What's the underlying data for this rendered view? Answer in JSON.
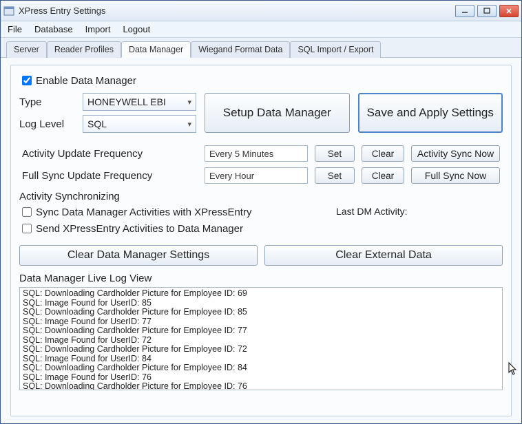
{
  "window": {
    "title": "XPress Entry Settings"
  },
  "menu": {
    "items": [
      "File",
      "Database",
      "Import",
      "Logout"
    ]
  },
  "tabs": {
    "items": [
      "Server",
      "Reader Profiles",
      "Data Manager",
      "Wiegand Format Data",
      "SQL Import / Export"
    ],
    "active": 2
  },
  "enable": {
    "label": "Enable Data Manager",
    "checked": true
  },
  "type": {
    "label": "Type",
    "value": "HONEYWELL EBI"
  },
  "loglevel": {
    "label": "Log Level",
    "value": "SQL"
  },
  "buttons": {
    "setup": "Setup Data Manager",
    "save": "Save and Apply Settings",
    "set": "Set",
    "clear": "Clear",
    "activity_sync": "Activity Sync Now",
    "full_sync": "Full Sync Now",
    "clear_dm": "Clear Data Manager Settings",
    "clear_ext": "Clear External Data"
  },
  "freq": {
    "activity_label": "Activity Update Frequency",
    "activity_value": "Every 5 Minutes",
    "full_label": "Full Sync Update Frequency",
    "full_value": "Every Hour"
  },
  "sync": {
    "title": "Activity Synchronizing",
    "opt1": "Sync Data Manager Activities with XPressEntry",
    "opt2": "Send XPressEntry Activities to Data Manager",
    "last_dm": "Last DM Activity:"
  },
  "log": {
    "title": "Data Manager Live Log View",
    "lines": [
      "SQL: Downloading Cardholder Picture for Employee ID: 69",
      "SQL: Image Found for UserID: 85",
      "SQL: Downloading Cardholder Picture for Employee ID: 85",
      "SQL: Image Found for UserID: 77",
      "SQL: Downloading Cardholder Picture for Employee ID: 77",
      "SQL: Image Found for UserID: 72",
      "SQL: Downloading Cardholder Picture for Employee ID: 72",
      "SQL: Image Found for UserID: 84",
      "SQL: Downloading Cardholder Picture for Employee ID: 84",
      "SQL: Image Found for UserID: 76",
      "SQL: Downloading Cardholder Picture for Employee ID: 76"
    ]
  }
}
